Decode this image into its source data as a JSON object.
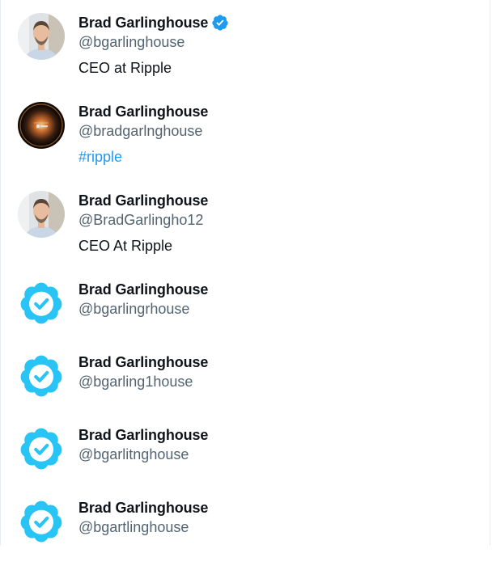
{
  "accounts": [
    {
      "name": "Brad Garlinghouse",
      "handle": "@bgarlinghouse",
      "bio": "CEO at Ripple",
      "verified": true,
      "avatar": "person-photo"
    },
    {
      "name": "Brad Garlinghouse",
      "handle": "@bradgarlnghouse",
      "bio": "#ripple",
      "verified": false,
      "avatar": "ripple-logo-photo"
    },
    {
      "name": "Brad Garlinghouse",
      "handle": "@BradGarlingho12",
      "bio": "CEO At Ripple",
      "verified": false,
      "avatar": "person-photo"
    },
    {
      "name": "Brad Garlinghouse",
      "handle": "@bgarlingrhouse",
      "bio": "",
      "verified": false,
      "avatar": "verified-badge-image"
    },
    {
      "name": "Brad Garlinghouse",
      "handle": "@bgarling1house",
      "bio": "",
      "verified": false,
      "avatar": "verified-badge-image"
    },
    {
      "name": "Brad Garlinghouse",
      "handle": "@bgarlitnghouse",
      "bio": "",
      "verified": false,
      "avatar": "verified-badge-image"
    },
    {
      "name": "Brad Garlinghouse",
      "handle": "@bgartlinghouse",
      "bio": "",
      "verified": false,
      "avatar": "verified-badge-image"
    }
  ],
  "colors": {
    "verified_blue": "#1d9bf0",
    "avatar_badge_blue": "#27c4f5",
    "handle_gray": "#536471",
    "name_black": "#0f1419"
  }
}
